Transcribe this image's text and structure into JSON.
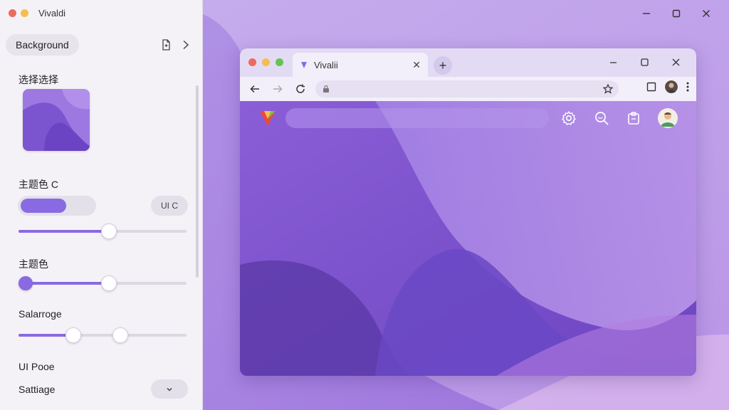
{
  "app": {
    "title": "Vivaldi"
  },
  "window": {
    "minimize_label": "minimize",
    "maximize_label": "maximize",
    "close_label": "close"
  },
  "settings": {
    "section_label": "Background",
    "image_label": "选择选择",
    "theme_color_c_label": "主题色 C",
    "ui_chip_label": "UI C",
    "theme_color_label": "主题色",
    "saturation_label": "Salarroge",
    "ui_pose_label": "UI Pooe",
    "setting_label": "Sattiage",
    "accent_color": "#8a6ae2",
    "slider_theme_c_value": 0.54,
    "slider_theme_value": 0.54,
    "slider_saturation_value": 0.31
  },
  "browser": {
    "tab_title": "Vivalii",
    "address_value": "",
    "address_placeholder": "",
    "search_placeholder": "",
    "colors": {
      "traffic_red": "#ed6a5e",
      "traffic_yellow": "#f4be4f",
      "traffic_green": "#61c554"
    }
  }
}
